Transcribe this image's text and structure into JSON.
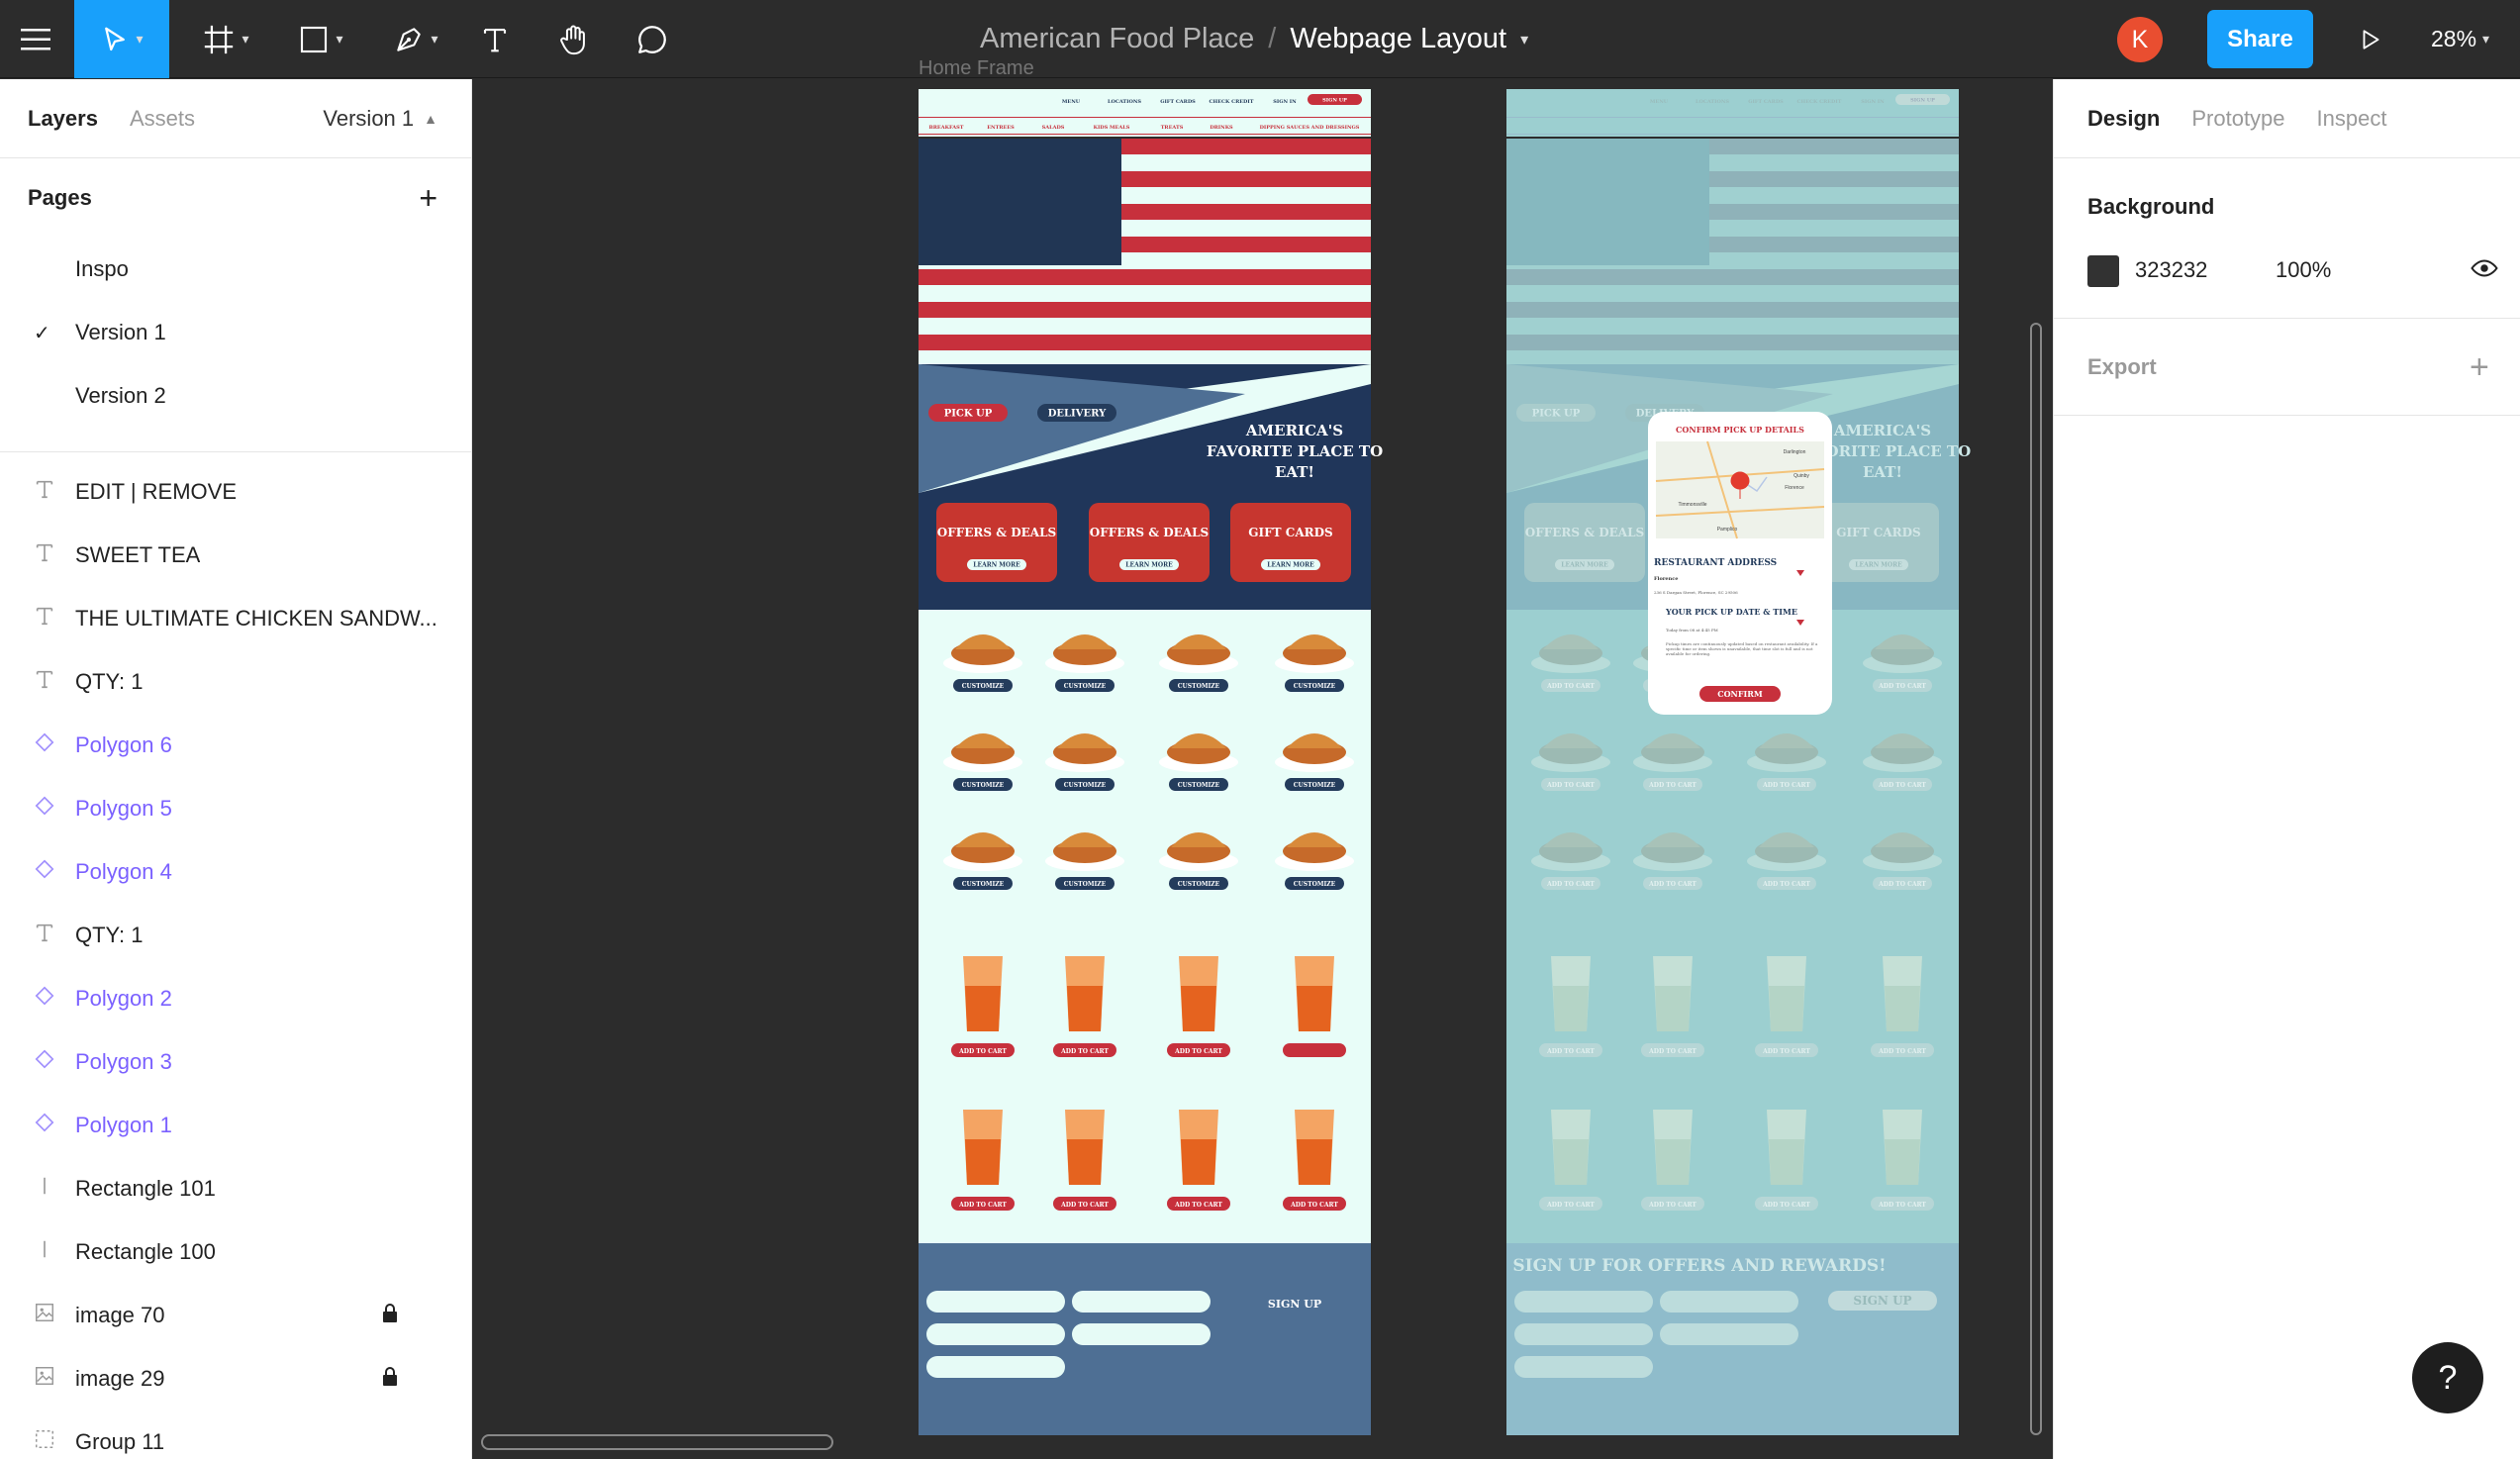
{
  "toolbar": {
    "project": "American Food Place",
    "separator": "/",
    "file": "Webpage Layout",
    "avatar": "K",
    "share": "Share",
    "zoom": "28%",
    "accent": "#18a0fb"
  },
  "left_panel": {
    "tabs": [
      "Layers",
      "Assets"
    ],
    "version_selector": "Version 1",
    "pages_title": "Pages",
    "pages": [
      "Inspo",
      "Version 1",
      "Version 2"
    ],
    "current_page": "Version 1",
    "layers": [
      {
        "name": "EDIT | REMOVE",
        "icon": "text-icon"
      },
      {
        "name": "SWEET TEA",
        "icon": "text-icon"
      },
      {
        "name": "THE ULTIMATE CHICKEN SANDW...",
        "icon": "text-icon"
      },
      {
        "name": "QTY: 1",
        "icon": "text-icon"
      },
      {
        "name": "Polygon 6",
        "icon": "component-icon"
      },
      {
        "name": "Polygon 5",
        "icon": "component-icon"
      },
      {
        "name": "Polygon 4",
        "icon": "component-icon"
      },
      {
        "name": "QTY: 1",
        "icon": "text-icon"
      },
      {
        "name": "Polygon 2",
        "icon": "component-icon"
      },
      {
        "name": "Polygon 3",
        "icon": "component-icon"
      },
      {
        "name": "Polygon 1",
        "icon": "component-icon"
      },
      {
        "name": "Rectangle 101",
        "icon": "line-icon"
      },
      {
        "name": "Rectangle 100",
        "icon": "line-icon"
      },
      {
        "name": "image 70",
        "icon": "image-icon",
        "locked": true
      },
      {
        "name": "image 29",
        "icon": "image-icon",
        "locked": true
      },
      {
        "name": "Group 11",
        "icon": "group-icon"
      }
    ]
  },
  "right_panel": {
    "tabs": [
      "Design",
      "Prototype",
      "Inspect"
    ],
    "background_title": "Background",
    "background_hex": "323232",
    "background_opacity": "100%",
    "export_title": "Export"
  },
  "canvas": {
    "frame_label": "Home Frame",
    "nav_items": [
      "MENU",
      "LOCATIONS",
      "GIFT CARDS",
      "CHECK CREDIT",
      "SIGN IN",
      "SIGN UP"
    ],
    "menu_cats": [
      "BREAKFAST",
      "ENTREES",
      "SALADS",
      "KIDS MEALS",
      "TREATS",
      "DRINKS",
      "DIPPING SAUCES AND DRESSINGS"
    ],
    "pickup": "PICK UP",
    "delivery": "DELIVERY",
    "hero_lines": [
      "AMERICA'S",
      "FAVORITE PLACE TO",
      "EAT!"
    ],
    "promos": [
      {
        "title": "OFFERS & DEALS",
        "button": "LEARN MORE"
      },
      {
        "title": "OFFERS & DEALS",
        "button": "LEARN MORE"
      },
      {
        "title": "GIFT CARDS",
        "button": "LEARN MORE"
      }
    ],
    "customize": "CUSTOMIZE",
    "add_to_cart": "ADD TO CART",
    "signup": "SIGN UP",
    "signup_heading": "SIGN UP FOR OFFERS AND REWARDS!",
    "popup": {
      "title": "CONFIRM PICK UP DETAILS",
      "address_label": "RESTAURANT ADDRESS",
      "address_name": "Florence",
      "address_line": "236 S Dargan Street, Florence, SC 29506",
      "time_label": "YOUR PICK UP DATE & TIME",
      "time_value": "Today from 08 at 4:45 PM",
      "note": "Pickup times are continuously updated based on restaurant availability. If a specific time or item shown is unavailable, that time slot is full and is not available for ordering.",
      "confirm": "CONFIRM",
      "map_places": [
        "Darlington",
        "Quinby",
        "Florence",
        "Timmonsville",
        "Pamplico"
      ]
    },
    "colors": {
      "navy": "#243c5c",
      "red": "#c7303c",
      "mint": "#e8fdf8",
      "steel": "#4e6f94",
      "dim": "#9ccfd0"
    }
  }
}
